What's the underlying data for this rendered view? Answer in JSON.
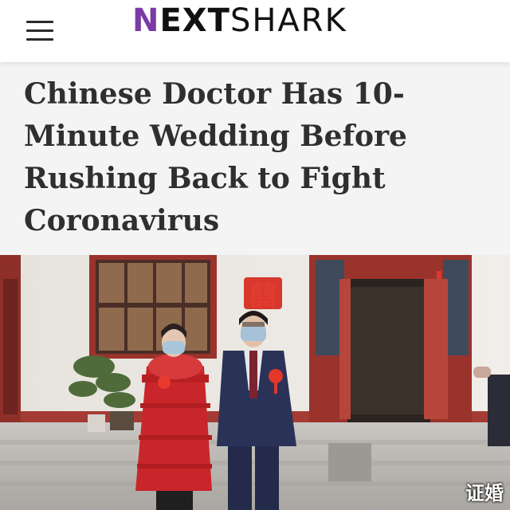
{
  "header": {
    "logo": {
      "mark": "N",
      "next": "EXT",
      "shark": "SHARK"
    },
    "menu_icon": "hamburger-menu-icon"
  },
  "article": {
    "headline": "Chinese Doctor Has 10-Minute Wedding Before Rushing Back to Fight Coronavirus"
  },
  "photo": {
    "caption": "证婚"
  },
  "colors": {
    "brand_purple": "#7b3aa6",
    "headline_text": "#2f2f2f",
    "headline_bg": "#f4f4f4"
  }
}
